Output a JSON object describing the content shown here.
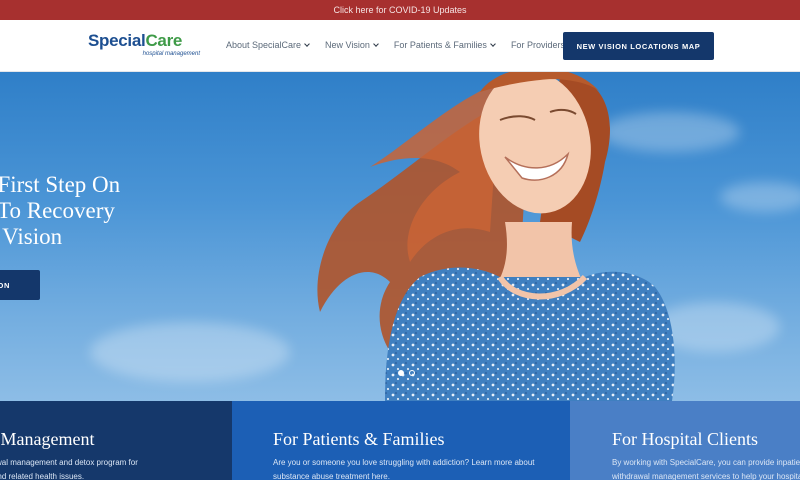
{
  "topbar": {
    "text": "Click here for COVID-19 Updates"
  },
  "header": {
    "logo": {
      "part_a": "Special",
      "part_b": "Care",
      "tagline": "hospital management"
    },
    "nav": [
      {
        "label": "About SpecialCare"
      },
      {
        "label": "New Vision"
      },
      {
        "label": "For Patients & Families"
      },
      {
        "label": "For Providers"
      }
    ],
    "cta_label": "NEW VISION LOCATIONS MAP"
  },
  "hero": {
    "title_lines": [
      "he First Step On",
      "ad To Recovery",
      "ew Vision"
    ],
    "button_label": "ON",
    "slider_dots": 2,
    "active_dot": 1
  },
  "cards": [
    {
      "title": "awal Management",
      "text_lines": [
        "patient withdrawal management and detox program for",
        "pioid, alcohol and related health issues."
      ]
    },
    {
      "title": "For Patients & Families",
      "text_lines": [
        "Are you or someone you love struggling with addiction? Learn more about",
        "substance abuse treatment here."
      ]
    },
    {
      "title": "For Hospital Clients",
      "text_lines": [
        "By working with SpecialCare, you can provide inpatient",
        "withdrawal management services to help your hospital"
      ]
    }
  ],
  "colors": {
    "topbar": "#a7302f",
    "navy": "#14376b",
    "card1": "#15386b",
    "card2": "#1c5fb5",
    "card3": "#4a7fc6",
    "logo_blue": "#1d4f91",
    "logo_green": "#3f9b48"
  }
}
